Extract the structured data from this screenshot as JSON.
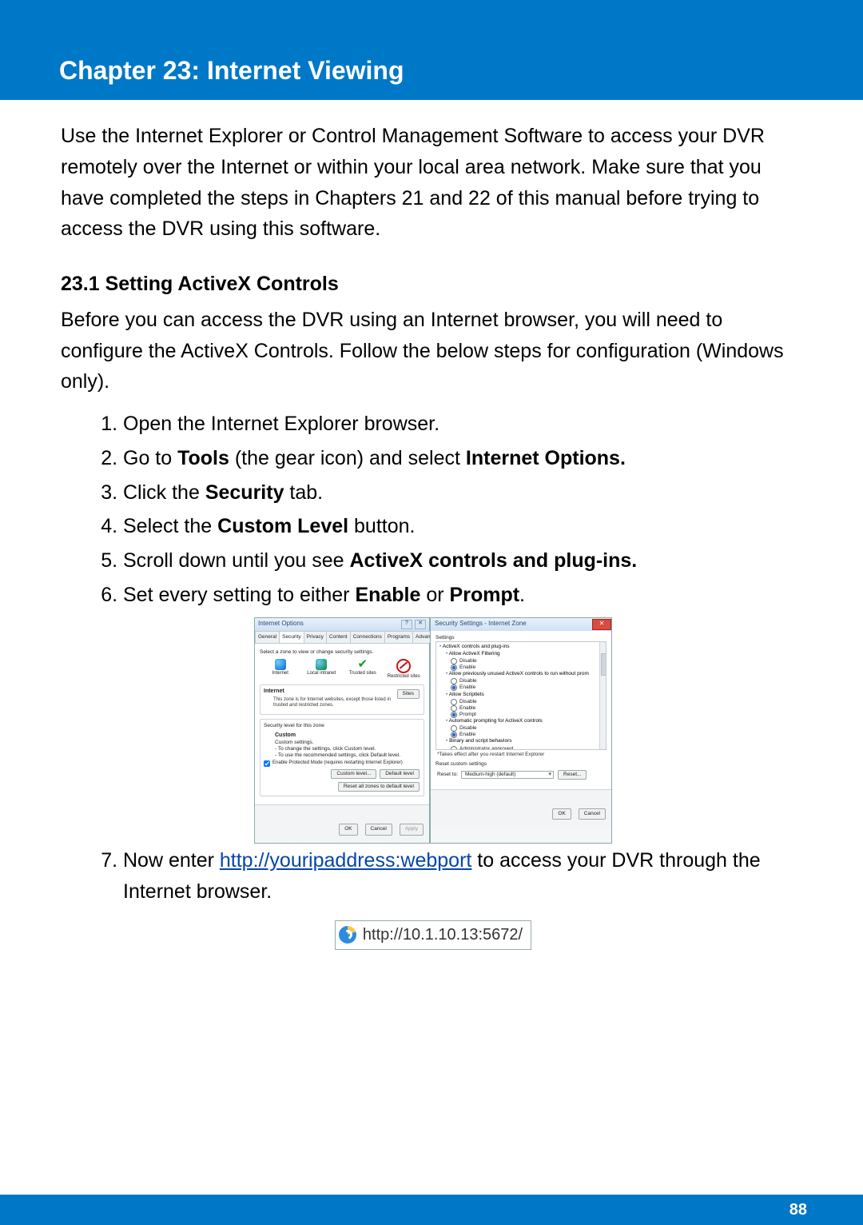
{
  "banner": {
    "title": "Chapter 23: Internet Viewing"
  },
  "intro": "Use the Internet Explorer or Control Management Software to access your DVR remotely over the Internet or within your local area network. Make sure that you have completed the steps in Chapters 21 and 22 of this manual before trying to access the DVR using this software.",
  "section": {
    "heading": "23.1 Setting ActiveX Controls",
    "intro": "Before you can access the DVR using an Internet browser, you will need to configure the ActiveX Controls. Follow the below steps for configuration (Windows only)."
  },
  "steps": {
    "s1": "Open the Internet Explorer browser.",
    "s2a": "Go to ",
    "s2b": "Tools",
    "s2c": " (the gear icon) and select ",
    "s2d": "Internet Options.",
    "s3a": "Click the ",
    "s3b": "Security",
    "s3c": " tab.",
    "s4a": "Select the ",
    "s4b": "Custom Level",
    "s4c": " button.",
    "s5a": "Scroll down until you see ",
    "s5b": "ActiveX controls and plug-ins.",
    "s6a": "Set every setting to either ",
    "s6b": "Enable",
    "s6c": " or ",
    "s6d": "Prompt",
    "s6e": ".",
    "s7a": "Now enter ",
    "s7link": "http://youripaddress:webport",
    "s7b": " to access your DVR through the Internet browser."
  },
  "io": {
    "title": "Internet Options",
    "tabs": [
      "General",
      "Security",
      "Privacy",
      "Content",
      "Connections",
      "Programs",
      "Advanced"
    ],
    "hint": "Select a zone to view or change security settings.",
    "zones": {
      "internet": "Internet",
      "local": "Local intranet",
      "trusted": "Trusted sites",
      "restricted": "Restricted sites"
    },
    "zonePanel": {
      "title": "Internet",
      "desc": "This zone is for Internet websites, except those listed in trusted and restricted zones.",
      "sites": "Sites"
    },
    "level": {
      "title": "Security level for this zone",
      "sub": "Custom",
      "l1": "Custom settings.",
      "l2": "- To change the settings, click Custom level.",
      "l3": "- To use the recommended settings, click Default level."
    },
    "protected": "Enable Protected Mode (requires restarting Internet Explorer)",
    "buttons": {
      "custom": "Custom level...",
      "default": "Default level",
      "resetAll": "Reset all zones to default level",
      "ok": "OK",
      "cancel": "Cancel",
      "apply": "Apply"
    }
  },
  "ss": {
    "title": "Security Settings - Internet Zone",
    "settingsLabel": "Settings",
    "tree": {
      "h1": "ActiveX controls and plug-ins",
      "h2": "Allow ActiveX Filtering",
      "h3": "Allow previously unused ActiveX controls to run without prom",
      "h4": "Allow Scriptlets",
      "h5": "Automatic prompting for ActiveX controls",
      "h6": "Binary and script behaviors",
      "h7": "Administrator approved",
      "oDisable": "Disable",
      "oEnable": "Enable",
      "oPrompt": "Prompt"
    },
    "note": "*Takes effect after you restart Internet Explorer",
    "resetLabel": "Reset custom settings",
    "resetTo": "Reset to:",
    "resetValue": "Medium-high (default)",
    "buttons": {
      "reset": "Reset...",
      "ok": "OK",
      "cancel": "Cancel"
    }
  },
  "addressbar": {
    "url": "http://10.1.10.13:5672/"
  },
  "page_number": "88"
}
